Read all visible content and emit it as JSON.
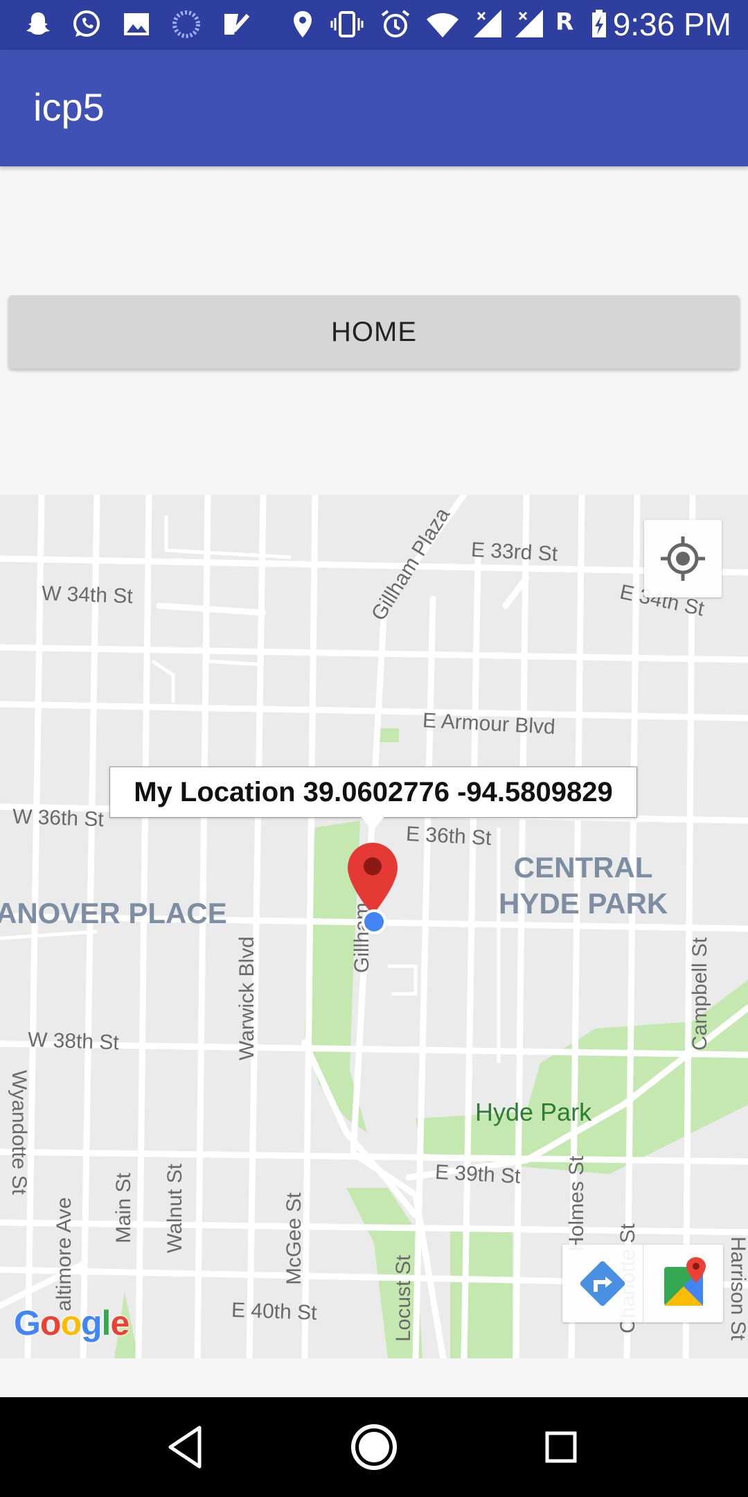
{
  "status_bar": {
    "time": "9:36 PM",
    "carrier_badge": "R",
    "icons": [
      "snapchat-icon",
      "whatsapp-icon",
      "gallery-icon",
      "loading-icon",
      "tasks-icon",
      "location-icon",
      "vibrate-icon",
      "alarm-icon",
      "wifi-icon",
      "signal-icon",
      "signal-icon",
      "roaming-icon",
      "battery-charging-icon"
    ]
  },
  "app_bar": {
    "title": "icp5"
  },
  "home_button": {
    "label": "HOME"
  },
  "map": {
    "info_window": "My Location 39.0602776 -94.5809829",
    "streets": {
      "e33": "E 33rd St",
      "w34": "W 34th St",
      "e34": "E 34th St",
      "gillham_plaza": "Gillham Plaza",
      "armour": "E Armour Blvd",
      "w36": "W 36th St",
      "e36": "E 36th St",
      "gillham": "Gillham",
      "warwick": "Warwick Blvd",
      "campbell": "Campbell St",
      "w38": "W 38th St",
      "e39": "E 39th St",
      "wyandotte": "Wyandotte St",
      "baltimore": "altimore Ave",
      "main": "Main St",
      "walnut": "Walnut St",
      "mcgee": "McGee St",
      "locust": "Locust St",
      "holmes": "Holmes St",
      "charlotte": "Charlotte St",
      "harrison": "Harrison St",
      "e40": "E 40th St"
    },
    "neighborhoods": {
      "hanover": "ANOVER PLACE",
      "central_hyde_line1": "CENTRAL",
      "central_hyde_line2": "HYDE PARK"
    },
    "park": "Hyde Park",
    "google_logo": {
      "g1": "G",
      "o1": "o",
      "o2": "o",
      "g2": "g",
      "l": "l",
      "e": "e"
    },
    "colors": {
      "road": "#ffffff",
      "land": "#ebebeb",
      "park": "#c5e8b0",
      "marker": "#e53935",
      "blue_dot": "#4285f4",
      "logo_blue": "#4285f4",
      "logo_red": "#ea4335",
      "logo_yellow": "#fbbc05",
      "logo_green": "#34a853"
    }
  },
  "nav_bar": {
    "buttons": [
      "back-icon",
      "home-circle-icon",
      "recents-icon"
    ]
  }
}
